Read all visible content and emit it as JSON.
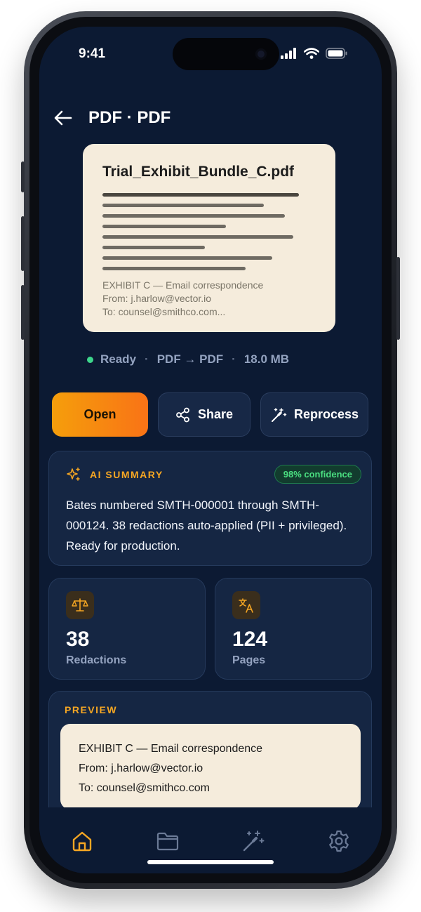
{
  "status_bar": {
    "time": "9:41"
  },
  "header": {
    "title": "PDF · PDF"
  },
  "document": {
    "filename": "Trial_Exhibit_Bundle_C.pdf",
    "snippet": [
      "EXHIBIT C — Email correspondence",
      "From: j.harlow@vector.io",
      "To: counsel@smithco.com..."
    ]
  },
  "meta": {
    "status": "Ready",
    "conversion": "PDF → PDF",
    "size": "18.0 MB",
    "status_color": "#3dd68c"
  },
  "actions": {
    "open_label": "Open",
    "share_label": "Share",
    "reprocess_label": "Reprocess"
  },
  "ai_summary": {
    "label": "AI SUMMARY",
    "confidence": "98% confidence",
    "text": "Bates numbered SMTH-000001 through SMTH-000124. 38 redactions auto-applied (PII + privileged). Ready for production."
  },
  "stats": [
    {
      "value": "38",
      "label": "Redactions",
      "icon": "scale-icon"
    },
    {
      "value": "124",
      "label": "Pages",
      "icon": "translate-icon"
    }
  ],
  "preview": {
    "label": "PREVIEW",
    "lines": [
      "EXHIBIT C — Email correspondence",
      "From: j.harlow@vector.io",
      "To: counsel@smithco.com"
    ]
  },
  "tabbar": {
    "items": [
      "home-icon",
      "folder-icon",
      "magic-wand-icon",
      "gear-icon"
    ],
    "active": "home-icon"
  },
  "colors": {
    "accent": "#f5a623",
    "background": "#0c1a33",
    "card": "#f5ecdc"
  }
}
